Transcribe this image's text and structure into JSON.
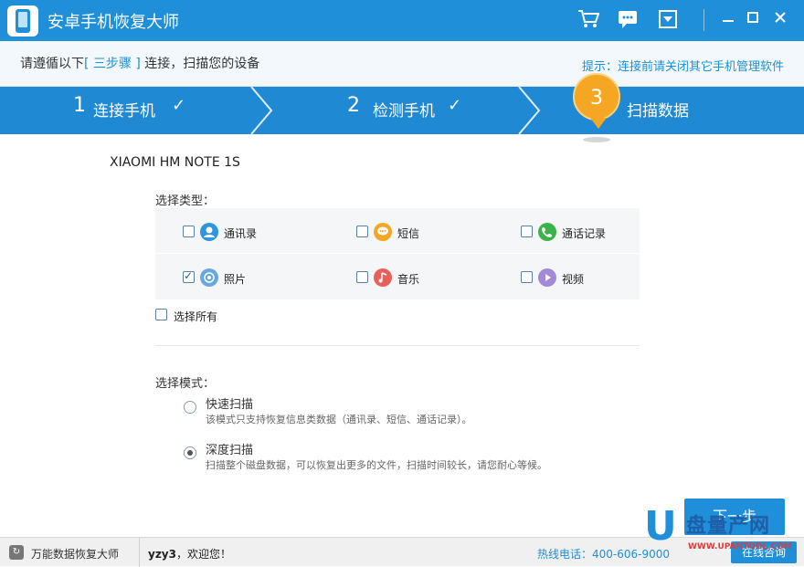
{
  "app": {
    "title": "安卓手机恢复大师"
  },
  "hint": {
    "left_prefix": "请遵循以下",
    "left_highlight": "[ 三步骤 ]",
    "left_suffix": "连接，扫描您的设备",
    "right": "提示：连接前请关闭其它手机管理软件"
  },
  "steps": [
    {
      "num": "1",
      "label": "连接手机",
      "done": true
    },
    {
      "num": "2",
      "label": "检测手机",
      "done": true
    },
    {
      "num": "3",
      "label": "扫描数据",
      "done": false
    }
  ],
  "device": "XIAOMI HM NOTE 1S",
  "types": {
    "label": "选择类型：",
    "items": [
      {
        "label": "通讯录",
        "checked": false,
        "icon": "contacts-icon",
        "color": "#2f95dc"
      },
      {
        "label": "短信",
        "checked": false,
        "icon": "sms-icon",
        "color": "#f5a623"
      },
      {
        "label": "通话记录",
        "checked": false,
        "icon": "call-log-icon",
        "color": "#3cb24a"
      },
      {
        "label": "照片",
        "checked": true,
        "icon": "photo-icon",
        "color": "#67a8e0"
      },
      {
        "label": "音乐",
        "checked": false,
        "icon": "music-icon",
        "color": "#e8605c"
      },
      {
        "label": "视频",
        "checked": false,
        "icon": "video-icon",
        "color": "#a38ad6"
      }
    ],
    "select_all": "选择所有"
  },
  "modes": {
    "label": "选择模式：",
    "items": [
      {
        "title": "快速扫描",
        "desc": "该模式只支持恢复信息类数据（通讯录、短信、通话记录）。",
        "selected": false
      },
      {
        "title": "深度扫描",
        "desc": "扫描整个磁盘数据，可以恢复出更多的文件，扫描时间较长，请您耐心等候。",
        "selected": true
      }
    ]
  },
  "next_label": "下一步",
  "footer": {
    "app": "万能数据恢复大师",
    "user_name": "yzy3",
    "welcome": "，欢迎您！",
    "phone": "热线电话：400-606-9000",
    "online": "在线咨询"
  },
  "watermark": {
    "letter": "U",
    "cn": "盘量产网",
    "en": "WWW.UPANTOOL.COM"
  }
}
